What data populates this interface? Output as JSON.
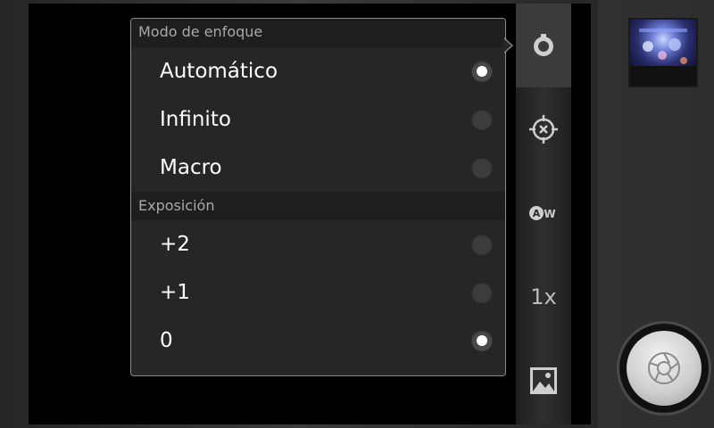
{
  "popup": {
    "focus_header": "Modo de enfoque",
    "focus_options": [
      {
        "label": "Automático",
        "selected": true
      },
      {
        "label": "Infinito",
        "selected": false
      },
      {
        "label": "Macro",
        "selected": false
      }
    ],
    "exposure_header": "Exposición",
    "exposure_options": [
      {
        "label": "+2",
        "selected": false
      },
      {
        "label": "+1",
        "selected": false
      },
      {
        "label": "0",
        "selected": true
      }
    ]
  },
  "side_strip": {
    "items": [
      {
        "icon": "focus-mode-icon"
      },
      {
        "icon": "metering-target-icon"
      },
      {
        "icon": "white-balance-auto-icon"
      },
      {
        "icon": "zoom",
        "label": "1x"
      },
      {
        "icon": "scene-landscape-icon"
      }
    ]
  },
  "colors": {
    "popup_bg": "#262626",
    "header_bg": "#1e1e1e",
    "header_text": "#a9a9a9",
    "option_text": "#ffffff"
  }
}
